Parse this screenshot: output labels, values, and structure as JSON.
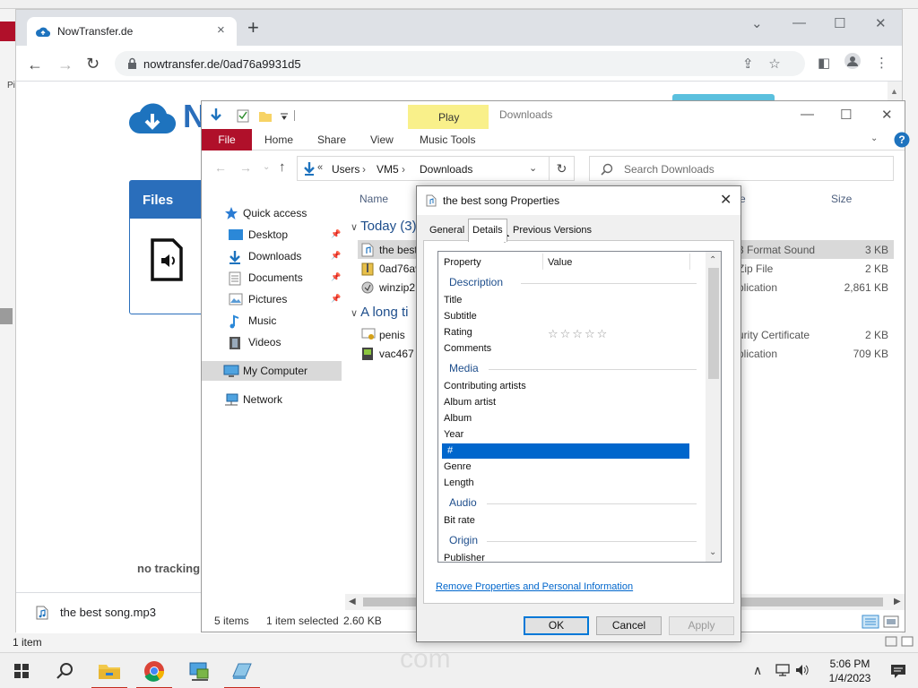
{
  "browser": {
    "tab_title": "NowTransfer.de",
    "url": "nowtransfer.de/0ad76a9931d5",
    "window_controls": [
      "⌄",
      "—",
      "☐",
      "✕"
    ]
  },
  "page": {
    "logo_letter": "N",
    "files_title": "Files",
    "no_tracking_text": "no tracking",
    "download_file": "the best song.mp3"
  },
  "background": {
    "pi_text": "Pi",
    "status_text": "1 item"
  },
  "explorer": {
    "qat_label": "Downloads",
    "contextual_tab": "Play",
    "ribbon": {
      "file": "File",
      "home": "Home",
      "share": "Share",
      "view": "View",
      "music_tools": "Music Tools"
    },
    "breadcrumb": [
      "Users",
      "VM5",
      "Downloads"
    ],
    "breadcrumb_prefix": "«",
    "search_placeholder": "Search Downloads",
    "nav": {
      "quick_access": "Quick access",
      "desktop": "Desktop",
      "downloads": "Downloads",
      "documents": "Documents",
      "pictures": "Pictures",
      "music": "Music",
      "videos": "Videos",
      "my_computer": "My Computer",
      "network": "Network"
    },
    "columns": {
      "name": "Name",
      "type": "e",
      "size": "Size"
    },
    "groups": {
      "today": "Today (3)",
      "long_time": "A long ti"
    },
    "rows": [
      {
        "name": "the best",
        "type": "3 Format Sound",
        "size": "3 KB"
      },
      {
        "name": "0ad76a9",
        "type": "Zip File",
        "size": "2 KB"
      },
      {
        "name": "winzip2",
        "type": "plication",
        "size": "2,861 KB"
      },
      {
        "name": "penis",
        "type": "urity Certificate",
        "size": "2 KB"
      },
      {
        "name": "vac467",
        "type": "plication",
        "size": "709 KB"
      }
    ],
    "status": {
      "items": "5 items",
      "selected": "1 item selected",
      "size": "2.60 KB"
    }
  },
  "dialog": {
    "title": "the best song Properties",
    "tabs": [
      "General",
      "Details",
      "Previous Versions"
    ],
    "header": {
      "property": "Property",
      "value": "Value"
    },
    "sections": {
      "description": "Description",
      "media": "Media",
      "audio": "Audio",
      "origin": "Origin"
    },
    "props": {
      "title": "Title",
      "subtitle": "Subtitle",
      "rating": "Rating",
      "comments": "Comments",
      "contributing_artists": "Contributing artists",
      "album_artist": "Album artist",
      "album": "Album",
      "year": "Year",
      "track_number": "#",
      "genre": "Genre",
      "length": "Length",
      "bit_rate": "Bit rate",
      "publisher": "Publisher"
    },
    "rating_stars": "☆☆☆☆☆",
    "rating_value": 0,
    "remove_link": "Remove Properties and Personal Information",
    "buttons": {
      "ok": "OK",
      "cancel": "Cancel",
      "apply": "Apply"
    }
  },
  "taskbar": {
    "watermark": "com",
    "time": "5:06 PM",
    "date": "1/4/2023"
  },
  "colors": {
    "accent": "#0078d7",
    "selection": "#0066cc",
    "ribbon_file": "#b0102a",
    "music_tools": "#f9f08a"
  }
}
